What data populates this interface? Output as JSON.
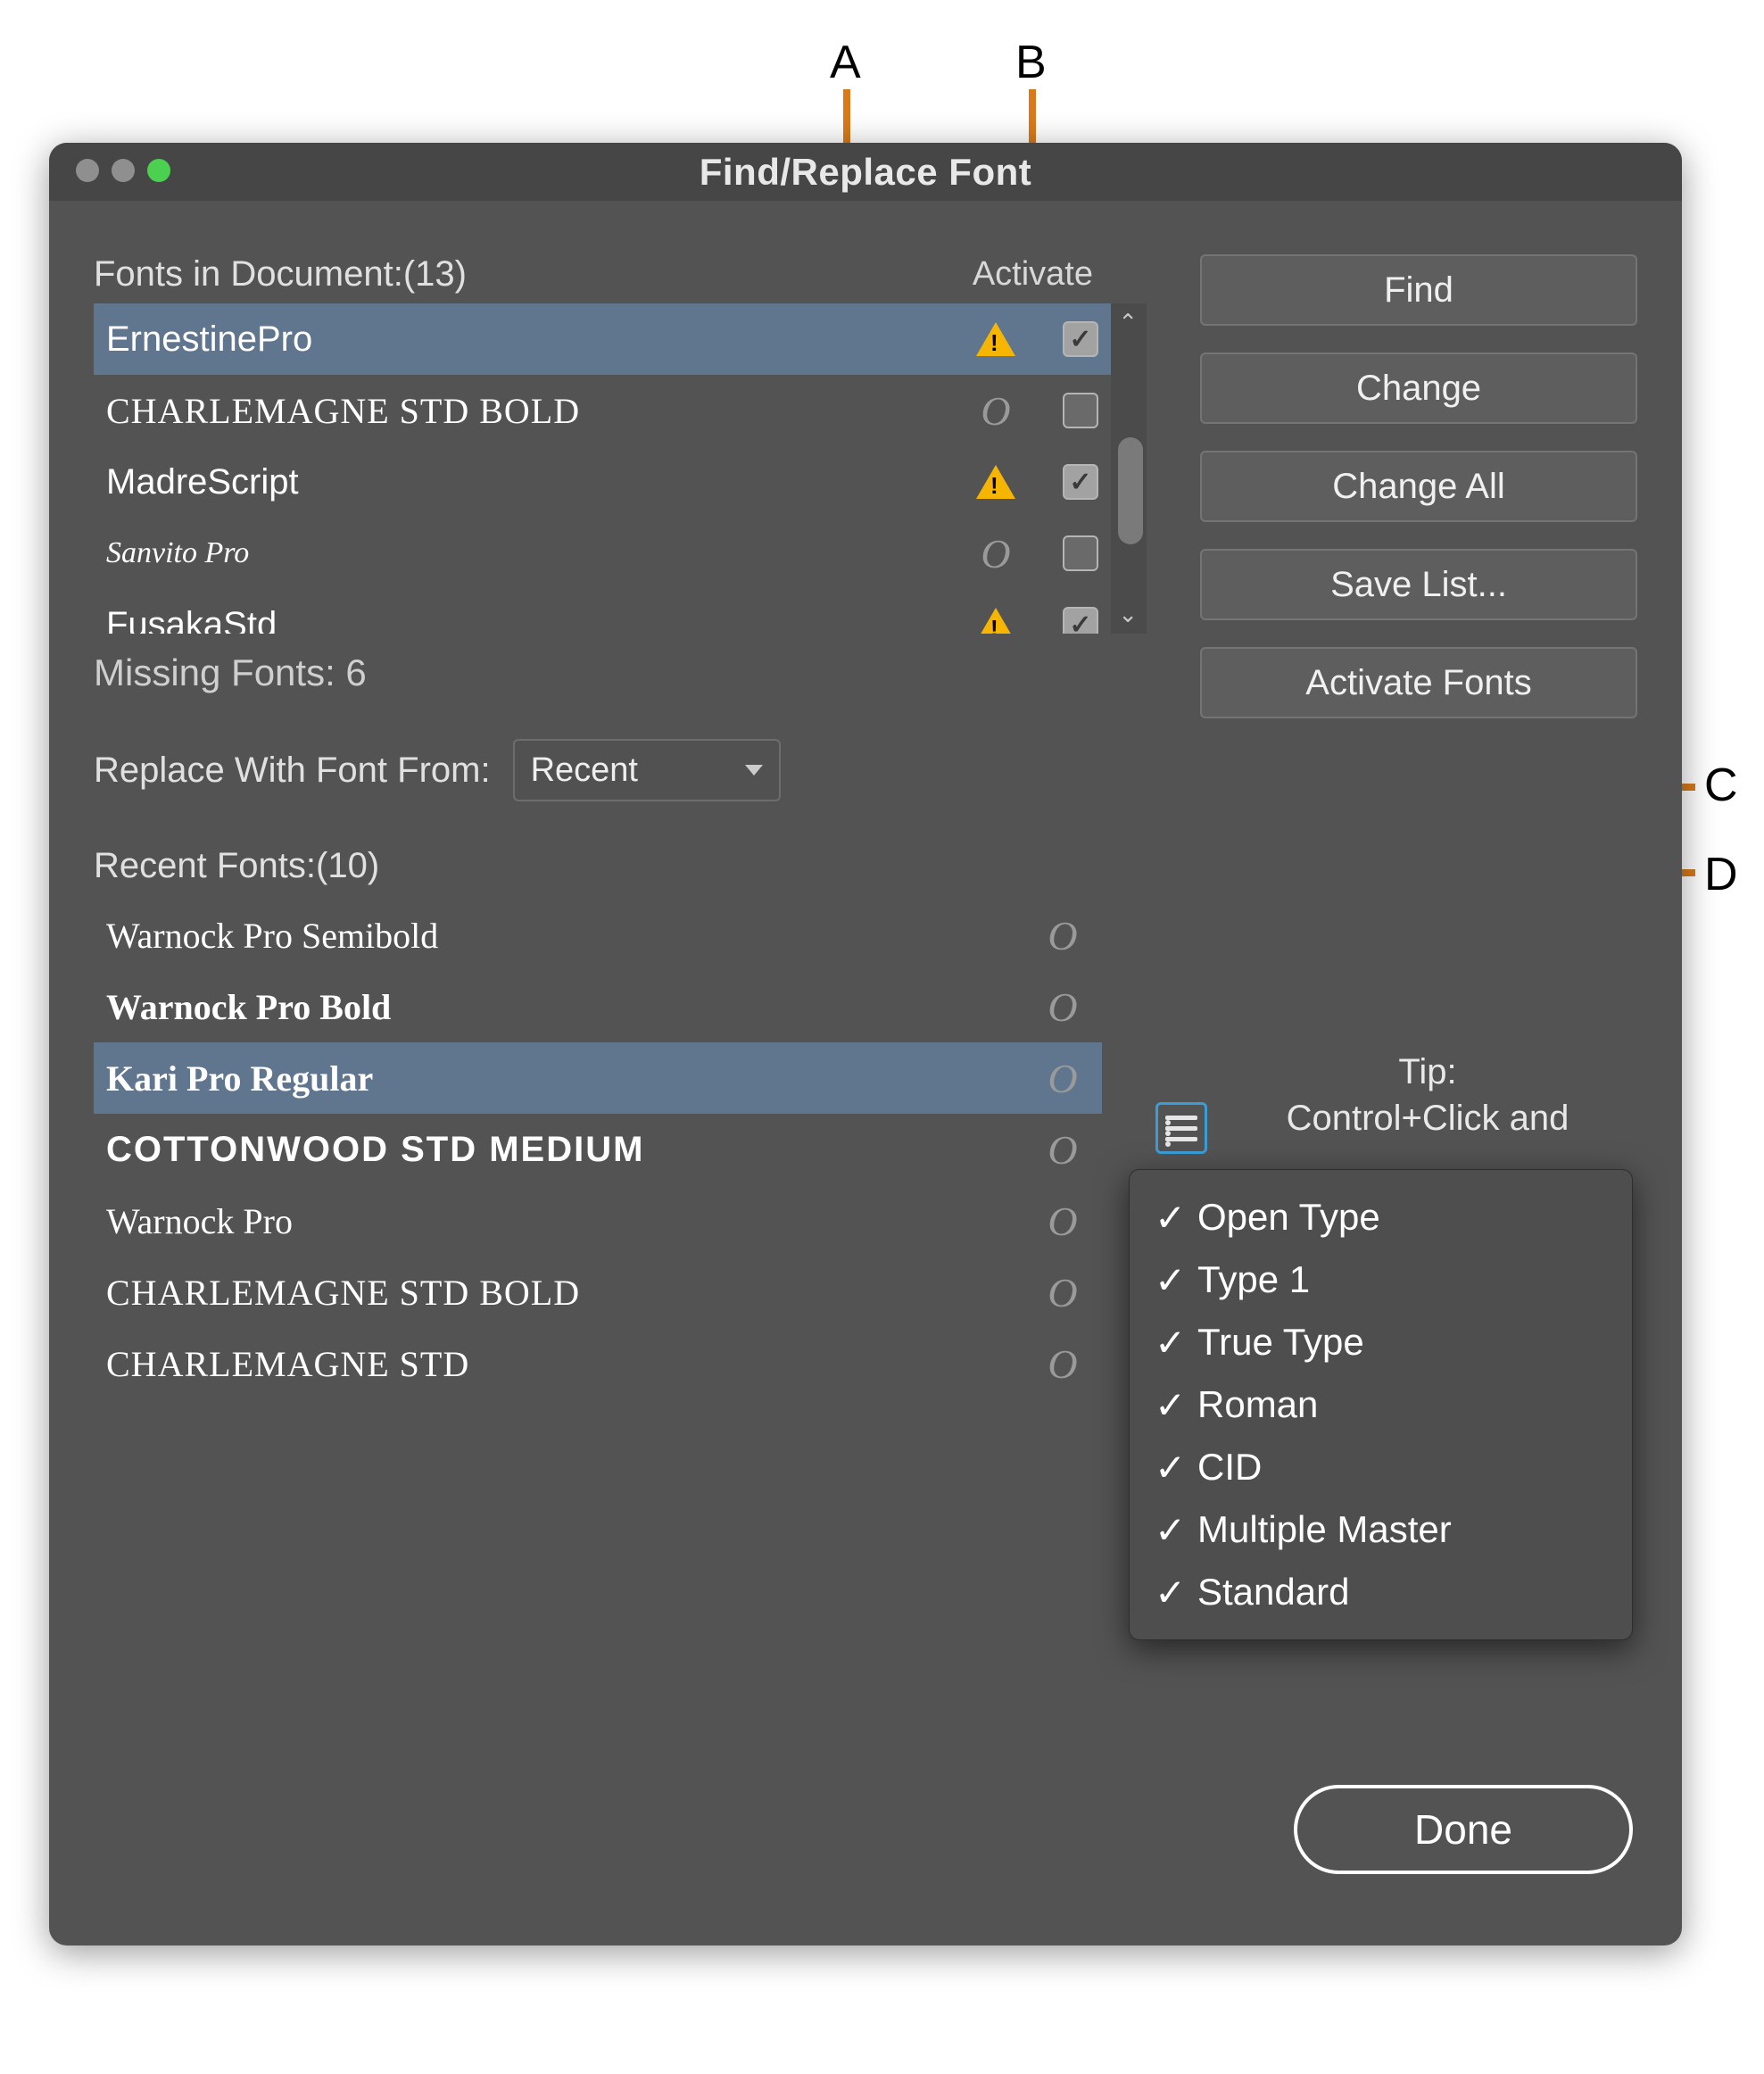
{
  "callouts": {
    "a": "A",
    "b": "B",
    "c": "C",
    "d": "D"
  },
  "title": "Find/Replace Font",
  "header": {
    "fonts_in_doc": "Fonts in Document:(13)",
    "activate": "Activate"
  },
  "doc_fonts": [
    {
      "name": "ErnestinePro",
      "cls": "fn-ernestine",
      "missing": true,
      "checked": true,
      "selected": true
    },
    {
      "name": "CHARLEMAGNE STD BOLD",
      "cls": "fn-charlemagne",
      "missing": false,
      "checked": false,
      "selected": false
    },
    {
      "name": "MadreScript",
      "cls": "fn-madre",
      "missing": true,
      "checked": true,
      "selected": false
    },
    {
      "name": "Sanvito Pro",
      "cls": "fn-sanvito",
      "missing": false,
      "checked": false,
      "selected": false
    },
    {
      "name": "FusakaStd",
      "cls": "fn-fusaka",
      "missing": true,
      "checked": true,
      "selected": false
    }
  ],
  "missing_label": "Missing Fonts: 6",
  "replace_label": "Replace With Font From:",
  "replace_source": "Recent",
  "recent_label": "Recent Fonts:(10)",
  "recent_fonts": [
    {
      "name": "Warnock Pro Semibold",
      "cls": "fn-warnocksemi",
      "selected": false
    },
    {
      "name": "Warnock Pro Bold",
      "cls": "fn-warnockbold",
      "selected": false
    },
    {
      "name": "Kari Pro Regular",
      "cls": "fn-kari",
      "selected": true
    },
    {
      "name": "COTTONWOOD STD MEDIUM",
      "cls": "fn-cotton",
      "selected": false
    },
    {
      "name": "Warnock Pro",
      "cls": "fn-warnock",
      "selected": false
    },
    {
      "name": "CHARLEMAGNE STD BOLD",
      "cls": "fn-charlemagne",
      "selected": false
    },
    {
      "name": "CHARLEMAGNE STD",
      "cls": "fn-charlemagne2",
      "selected": false
    }
  ],
  "buttons": {
    "find": "Find",
    "change": "Change",
    "change_all": "Change All",
    "save_list": "Save List...",
    "activate_fonts": "Activate Fonts",
    "done": "Done"
  },
  "tip": {
    "title": "Tip:",
    "line2": "Control+Click and"
  },
  "filter_menu": [
    "Open Type",
    "Type 1",
    "True Type",
    "Roman",
    "CID",
    "Multiple Master",
    "Standard"
  ]
}
